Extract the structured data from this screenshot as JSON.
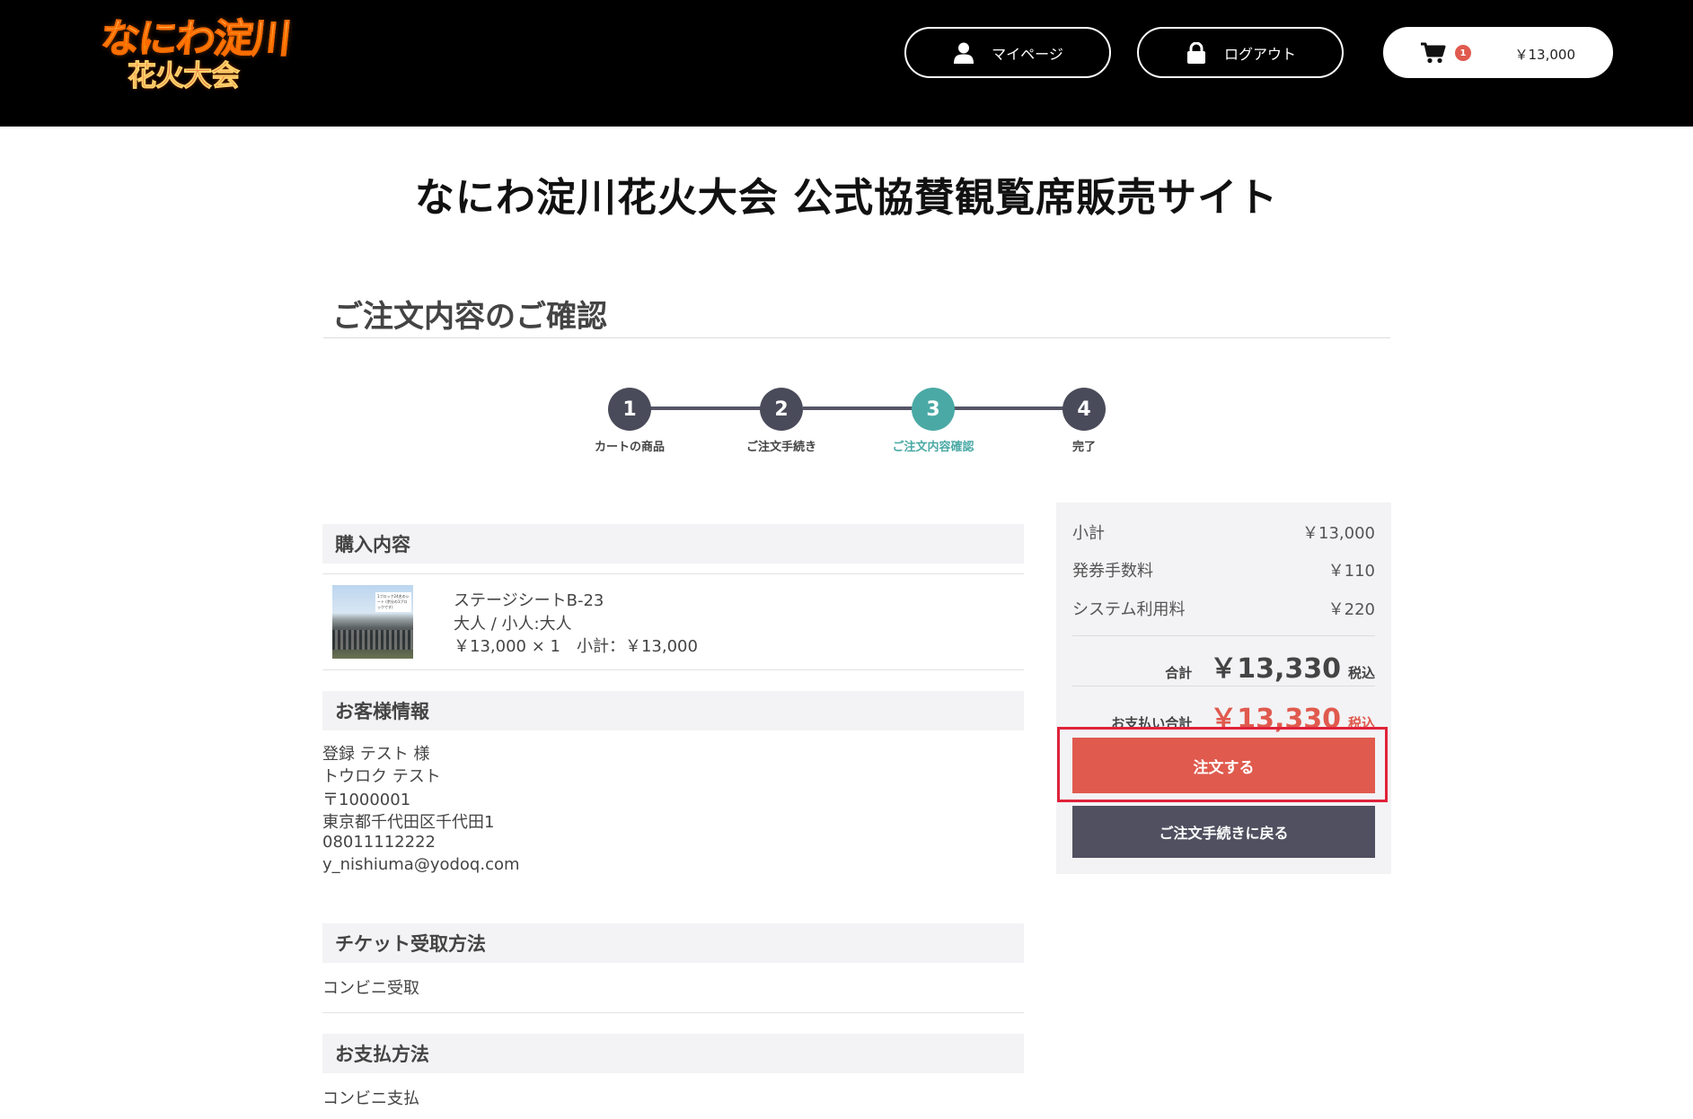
{
  "header": {
    "logo_line1": "なにわ淀川",
    "logo_line2": "花火大会",
    "mypage_label": "マイページ",
    "logout_label": "ログアウト",
    "cart_count": "1",
    "cart_total": "￥13,000"
  },
  "site_title": "なにわ淀川花火大会 公式協賛観覧席販売サイト",
  "page_heading": "ご注文内容のご確認",
  "steps": [
    {
      "num": "1",
      "label": "カートの商品"
    },
    {
      "num": "2",
      "label": "ご注文手続き"
    },
    {
      "num": "3",
      "label": "ご注文内容確認"
    },
    {
      "num": "4",
      "label": "完了"
    }
  ],
  "purchase": {
    "heading": "購入内容",
    "item_name": "ステージシートB-23",
    "item_type": "大人 / 小人:大人",
    "item_price": "￥13,000 × 1　小計：￥13,000",
    "thumb_sign": "1ブロック24名のシート (余分の1ブロックです)"
  },
  "customer": {
    "heading": "お客様情報",
    "lines": [
      "登録 テスト 様",
      "トウロク テスト",
      "〒1000001",
      "東京都千代田区千代田1",
      "08011112222",
      "y_nishiuma@yodoq.com"
    ]
  },
  "ticket": {
    "heading": "チケット受取方法",
    "value": "コンビニ受取"
  },
  "payment": {
    "heading": "お支払方法",
    "value": "コンビニ支払"
  },
  "summary": {
    "subtotal_label": "小計",
    "subtotal_value": "￥13,000",
    "ticket_fee_label": "発券手数料",
    "ticket_fee_value": "￥110",
    "system_fee_label": "システム利用料",
    "system_fee_value": "￥220",
    "total_label": "合計",
    "total_value": "￥13,330",
    "total_tax": "税込",
    "pay_label": "お支払い合計",
    "pay_value": "￥13,330",
    "pay_tax": "税込",
    "order_button": "注文する",
    "back_button": "ご注文手続きに戻る"
  },
  "colors": {
    "accent_red": "#e05a4e",
    "step_active": "#4aa9a5",
    "step_default": "#4a4b5a",
    "highlight": "#e0223a"
  }
}
